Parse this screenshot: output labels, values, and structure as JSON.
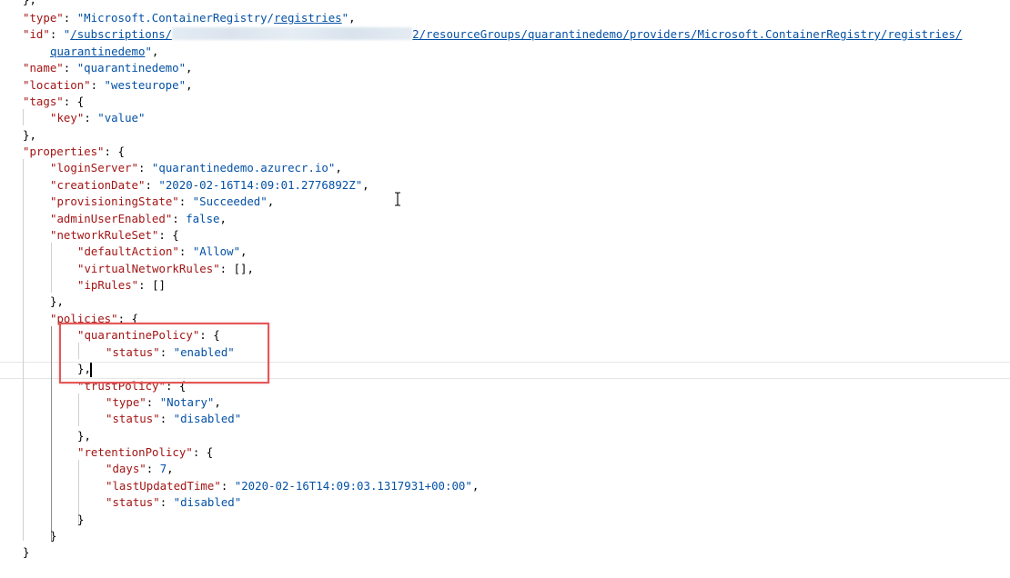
{
  "editor": {
    "lines": {
      "l0": {
        "close": "},"
      },
      "l1": {
        "key": "\"type\"",
        "colon": ": ",
        "val_a": "\"Microsoft.ContainerRegistry/",
        "val_link": "registries",
        "val_b": "\"",
        "end": ","
      },
      "l2": {
        "key": "\"id\"",
        "colon": ": ",
        "q": "\"",
        "val_a": "/subscriptions/",
        "val_b": "2/resourceGroups/quarantinedemo/providers/Microsoft.ContainerRegistry/registries/"
      },
      "l3": {
        "val": "quarantinedemo",
        "q": "\"",
        "end": ","
      },
      "l4": {
        "key": "\"name\"",
        "colon": ": ",
        "val": "\"quarantinedemo\"",
        "end": ","
      },
      "l5": {
        "key": "\"location\"",
        "colon": ": ",
        "val": "\"westeurope\"",
        "end": ","
      },
      "l6": {
        "key": "\"tags\"",
        "colon": ": ",
        "open": "{"
      },
      "l7": {
        "key": "\"key\"",
        "colon": ": ",
        "val": "\"value\""
      },
      "l8": {
        "close": "},"
      },
      "l9": {
        "key": "\"properties\"",
        "colon": ": ",
        "open": "{"
      },
      "l10": {
        "key": "\"loginServer\"",
        "colon": ": ",
        "val": "\"quarantinedemo.azurecr.io\"",
        "end": ","
      },
      "l11": {
        "key": "\"creationDate\"",
        "colon": ": ",
        "val": "\"2020-02-16T14:09:01.2776892Z\"",
        "end": ","
      },
      "l12": {
        "key": "\"provisioningState\"",
        "colon": ": ",
        "val": "\"Succeeded\"",
        "end": ","
      },
      "l13": {
        "key": "\"adminUserEnabled\"",
        "colon": ": ",
        "val": "false",
        "end": ","
      },
      "l14": {
        "key": "\"networkRuleSet\"",
        "colon": ": ",
        "open": "{"
      },
      "l15": {
        "key": "\"defaultAction\"",
        "colon": ": ",
        "val": "\"Allow\"",
        "end": ","
      },
      "l16": {
        "key": "\"virtualNetworkRules\"",
        "colon": ": ",
        "val": "[]",
        "end": ","
      },
      "l17": {
        "key": "\"ipRules\"",
        "colon": ": ",
        "val": "[]"
      },
      "l18": {
        "close": "},"
      },
      "l19": {
        "key": "\"policies\"",
        "colon": ": ",
        "open": "{"
      },
      "l20": {
        "key": "\"quarantinePolicy\"",
        "colon": ": ",
        "open": "{"
      },
      "l21": {
        "key": "\"status\"",
        "colon": ": ",
        "val": "\"enabled\""
      },
      "l22": {
        "close": "},"
      },
      "l23": {
        "key": "\"trustPolicy\"",
        "colon": ": ",
        "open": "{"
      },
      "l24": {
        "key": "\"type\"",
        "colon": ": ",
        "val": "\"Notary\"",
        "end": ","
      },
      "l25": {
        "key": "\"status\"",
        "colon": ": ",
        "val": "\"disabled\""
      },
      "l26": {
        "close": "},"
      },
      "l27": {
        "key": "\"retentionPolicy\"",
        "colon": ": ",
        "open": "{"
      },
      "l28": {
        "key": "\"days\"",
        "colon": ": ",
        "val": "7",
        "end": ","
      },
      "l29": {
        "key": "\"lastUpdatedTime\"",
        "colon": ": ",
        "val": "\"2020-02-16T14:09:03.1317931+00:00\"",
        "end": ","
      },
      "l30": {
        "key": "\"status\"",
        "colon": ": ",
        "val": "\"disabled\""
      },
      "l31": {
        "close": "}"
      },
      "l32": {
        "close": "}"
      },
      "l33": {
        "close": "}"
      }
    },
    "colors": {
      "key": "#a31515",
      "string": "#0451a5",
      "punctuation": "#000000",
      "highlight_border": "#e45858"
    },
    "icons": {
      "pointer": "i-beam-cursor-icon"
    }
  }
}
